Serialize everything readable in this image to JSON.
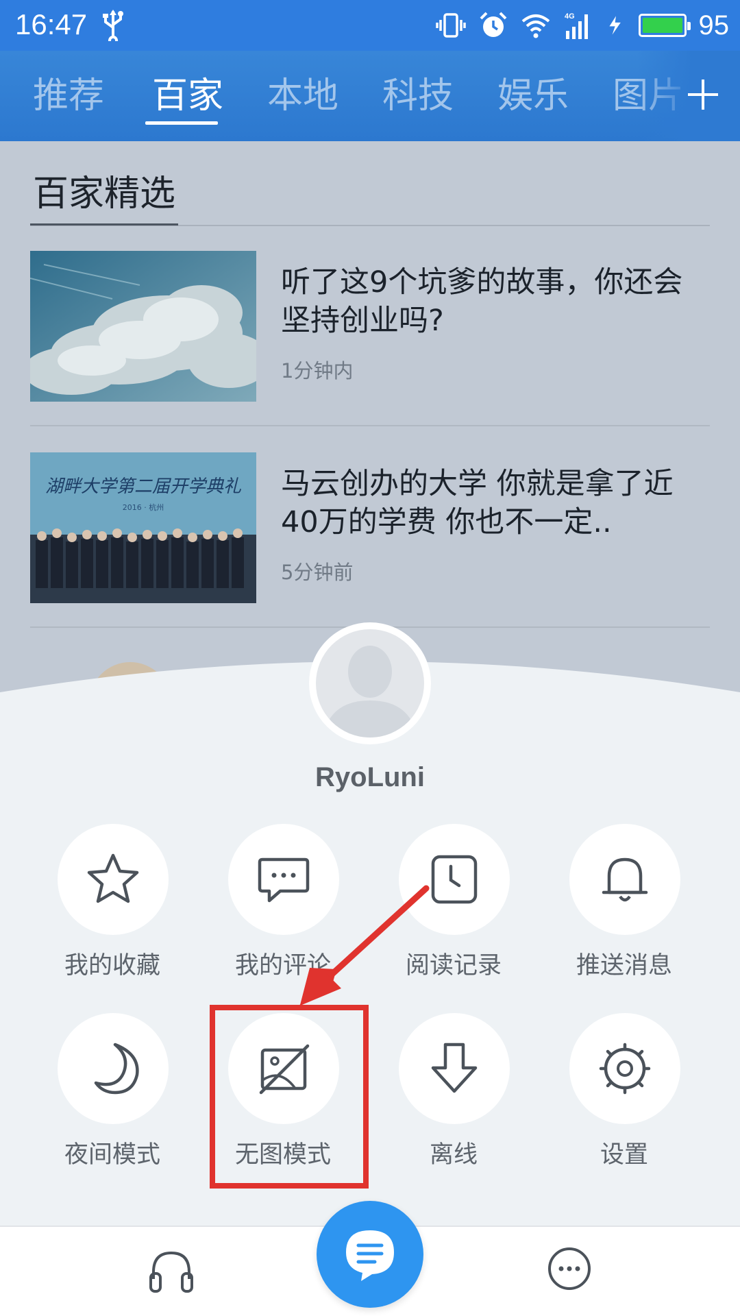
{
  "status_bar": {
    "time": "16:47",
    "battery_percent": "95",
    "icons": [
      "usb-icon",
      "vibrate-icon",
      "alarm-icon",
      "wifi-icon",
      "signal-4g-icon",
      "charging-icon",
      "battery-icon"
    ]
  },
  "tabs": [
    {
      "label": "推荐",
      "active": false
    },
    {
      "label": "百家",
      "active": true
    },
    {
      "label": "本地",
      "active": false
    },
    {
      "label": "科技",
      "active": false
    },
    {
      "label": "娱乐",
      "active": false
    },
    {
      "label": "图片",
      "active": false
    }
  ],
  "feed": {
    "section_title": "百家精选",
    "articles": [
      {
        "title": "听了这9个坑爹的故事，你还会坚持创业吗?",
        "time": "1分钟内"
      },
      {
        "title": "马云创办的大学 你就是拿了近40万的学费 你也不一定..",
        "time": "5分钟前",
        "thumb_banner": "湖畔大学第二届开学典礼",
        "thumb_subtitle": "2016 · 杭州"
      }
    ]
  },
  "sheet": {
    "username": "RyoLuni",
    "menu": [
      {
        "label": "我的收藏",
        "icon": "star-icon"
      },
      {
        "label": "我的评论",
        "icon": "comment-icon"
      },
      {
        "label": "阅读记录",
        "icon": "clock-icon"
      },
      {
        "label": "推送消息",
        "icon": "bell-icon"
      },
      {
        "label": "夜间模式",
        "icon": "moon-icon"
      },
      {
        "label": "无图模式",
        "icon": "no-image-icon"
      },
      {
        "label": "离线",
        "icon": "download-icon"
      },
      {
        "label": "设置",
        "icon": "gear-icon"
      }
    ]
  },
  "bottom_nav": {
    "left_icon": "headphones-icon",
    "center_icon": "message-icon",
    "right_icon": "more-icon"
  },
  "colors": {
    "primary": "#2f7ddf",
    "fab": "#2e95f0",
    "highlight": "#e0332e",
    "sheet_bg": "#eef2f5"
  }
}
